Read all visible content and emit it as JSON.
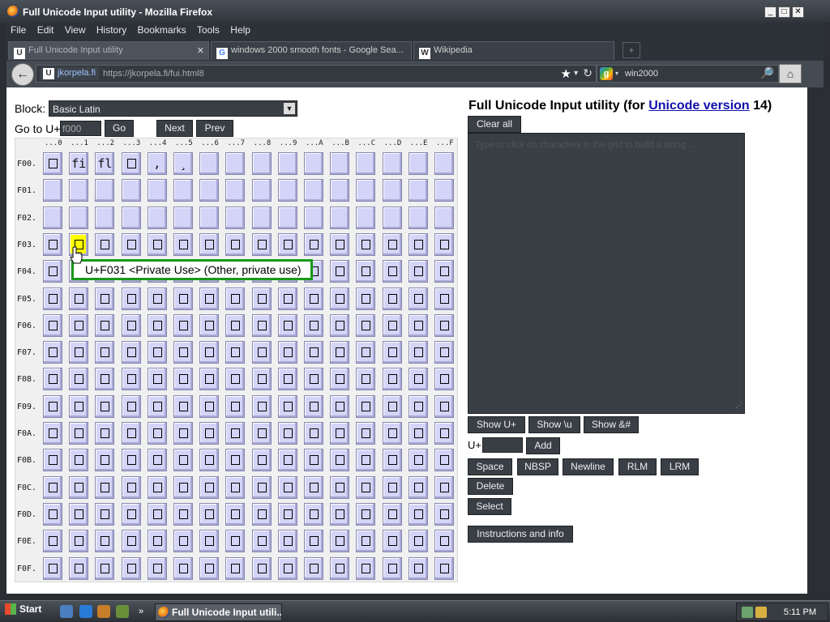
{
  "window": {
    "title": "Full Unicode Input utility - Mozilla Firefox",
    "min": "_",
    "max": "□",
    "close": "✕"
  },
  "menu": [
    "File",
    "Edit",
    "View",
    "History",
    "Bookmarks",
    "Tools",
    "Help"
  ],
  "tabs": [
    {
      "label": "Full Unicode Input utility",
      "icon": "U",
      "close": "✕"
    },
    {
      "label": "windows 2000 smooth fonts - Google Sea...",
      "icon": "G"
    },
    {
      "label": "Wikipedia",
      "icon": "W"
    }
  ],
  "newtab": "+",
  "nav": {
    "back": "←",
    "site": "jkorpela.fi",
    "url": "https://jkorpela.fi/fui.html8",
    "star": "★",
    "dropdown": "▼",
    "reload": "↻",
    "search_value": "win2000",
    "search_engine_icon": "g",
    "search_dd": "▾",
    "magnifier": "🔎",
    "home": "⌂",
    "site_icon": "U"
  },
  "page": {
    "block_label": "Block:",
    "block_value": "Basic Latin",
    "block_arrow": "▼",
    "goto_label": "Go to U+",
    "goto_value": "f000",
    "go_button": "Go",
    "next_button": "Next",
    "prev_button": "Prev",
    "heading_prefix": "Full Unicode Input utility (for ",
    "heading_link": "Unicode version",
    "heading_suffix": " 14)",
    "clear_all": "Clear all",
    "textarea_hint": "Type or click on characters in the grid to build a string ...",
    "show_u": "Show U+",
    "show_backslash_u": "Show \\u",
    "show_amp": "Show &#",
    "uplus_label": "U+",
    "add_button": "Add",
    "space": "Space",
    "nbsp": "NBSP",
    "newline": "Newline",
    "rlm": "RLM",
    "lrm": "LRM",
    "delete": "Delete",
    "select": "Select",
    "instructions": "Instructions and info",
    "tooltip": "U+F031 <Private Use> (Other, private use)",
    "textarea_grip": "⋰"
  },
  "grid": {
    "columns": [
      "...0",
      "...1",
      "...2",
      "...3",
      "...4",
      "...5",
      "...6",
      "...7",
      "...8",
      "...9",
      "...A",
      "...B",
      "...C",
      "...D",
      "...E",
      "...F"
    ],
    "rows": [
      "F00.",
      "F01.",
      "F02.",
      "F03.",
      "F04.",
      "F05.",
      "F06.",
      "F07.",
      "F08.",
      "F09.",
      "F0A.",
      "F0B.",
      "F0C.",
      "F0D.",
      "F0E.",
      "F0F."
    ],
    "row0_glyphs": [
      "",
      "fi",
      "fl",
      "",
      ",",
      "¸"
    ],
    "highlight_code": "F031",
    "highlight_color": "#ffff00",
    "cell_color": "#d4d4f8"
  },
  "taskbar": {
    "start": "Start",
    "task": "Full Unicode Input utili...",
    "more": "»",
    "clock": "5:11 PM"
  }
}
